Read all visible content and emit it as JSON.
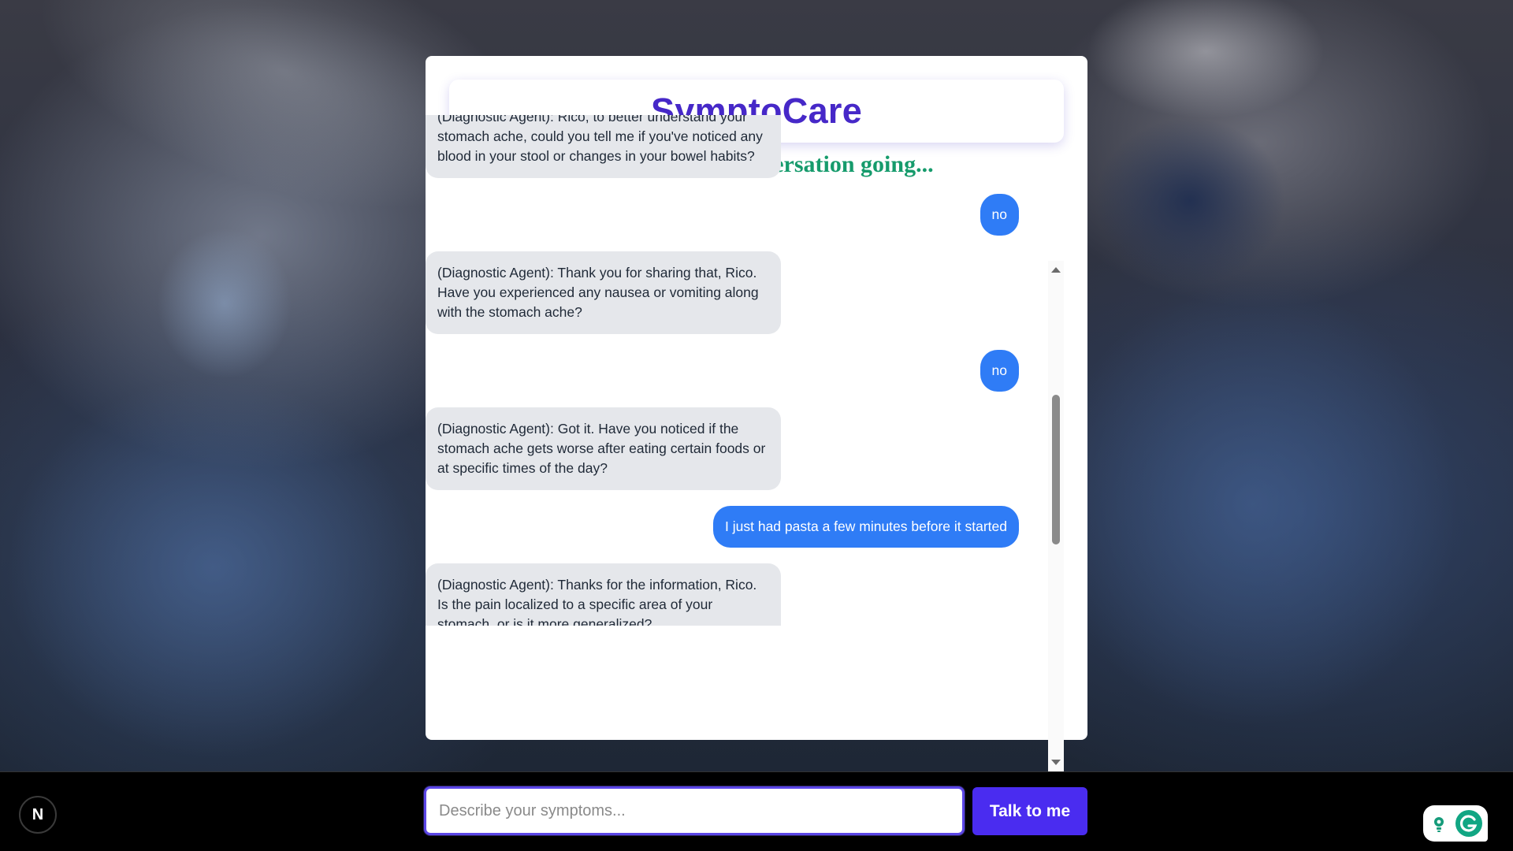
{
  "app": {
    "title": "SymptoCare",
    "subtitle": "Let's keep the conversation going..."
  },
  "chat": {
    "messages": [
      {
        "role": "agent",
        "text": "(Diagnostic Agent): Rico, to better understand your stomach ache, could you tell me if you've noticed any blood in your stool or changes in your bowel habits?"
      },
      {
        "role": "user",
        "text": "no"
      },
      {
        "role": "agent",
        "text": "(Diagnostic Agent): Thank you for sharing that, Rico. Have you experienced any nausea or vomiting along with the stomach ache?"
      },
      {
        "role": "user",
        "text": "no"
      },
      {
        "role": "agent",
        "text": "(Diagnostic Agent): Got it. Have you noticed if the stomach ache gets worse after eating certain foods or at specific times of the day?"
      },
      {
        "role": "user",
        "text": "I just had pasta a few minutes before it started"
      },
      {
        "role": "agent",
        "text": "(Diagnostic Agent): Thanks for the information, Rico. Is the pain localized to a specific area of your stomach, or is it more generalized?"
      }
    ]
  },
  "input": {
    "placeholder": "Describe your symptoms...",
    "value": ""
  },
  "actions": {
    "submit_label": "Talk to me"
  },
  "badges": {
    "next_label": "N"
  },
  "colors": {
    "title": "#4628c8",
    "subtitle": "#169b6c",
    "user_bubble": "#2f7cf6",
    "agent_bubble": "#e5e7eb",
    "button": "#4a2cf0",
    "input_border": "#5b46e6"
  },
  "icons": {
    "next_badge": "nextjs-logo-icon",
    "grammarly_hint": "lightbulb-icon",
    "grammarly_logo": "grammarly-g-icon",
    "scroll_up": "scroll-up-arrow-icon",
    "scroll_down": "scroll-down-arrow-icon"
  }
}
